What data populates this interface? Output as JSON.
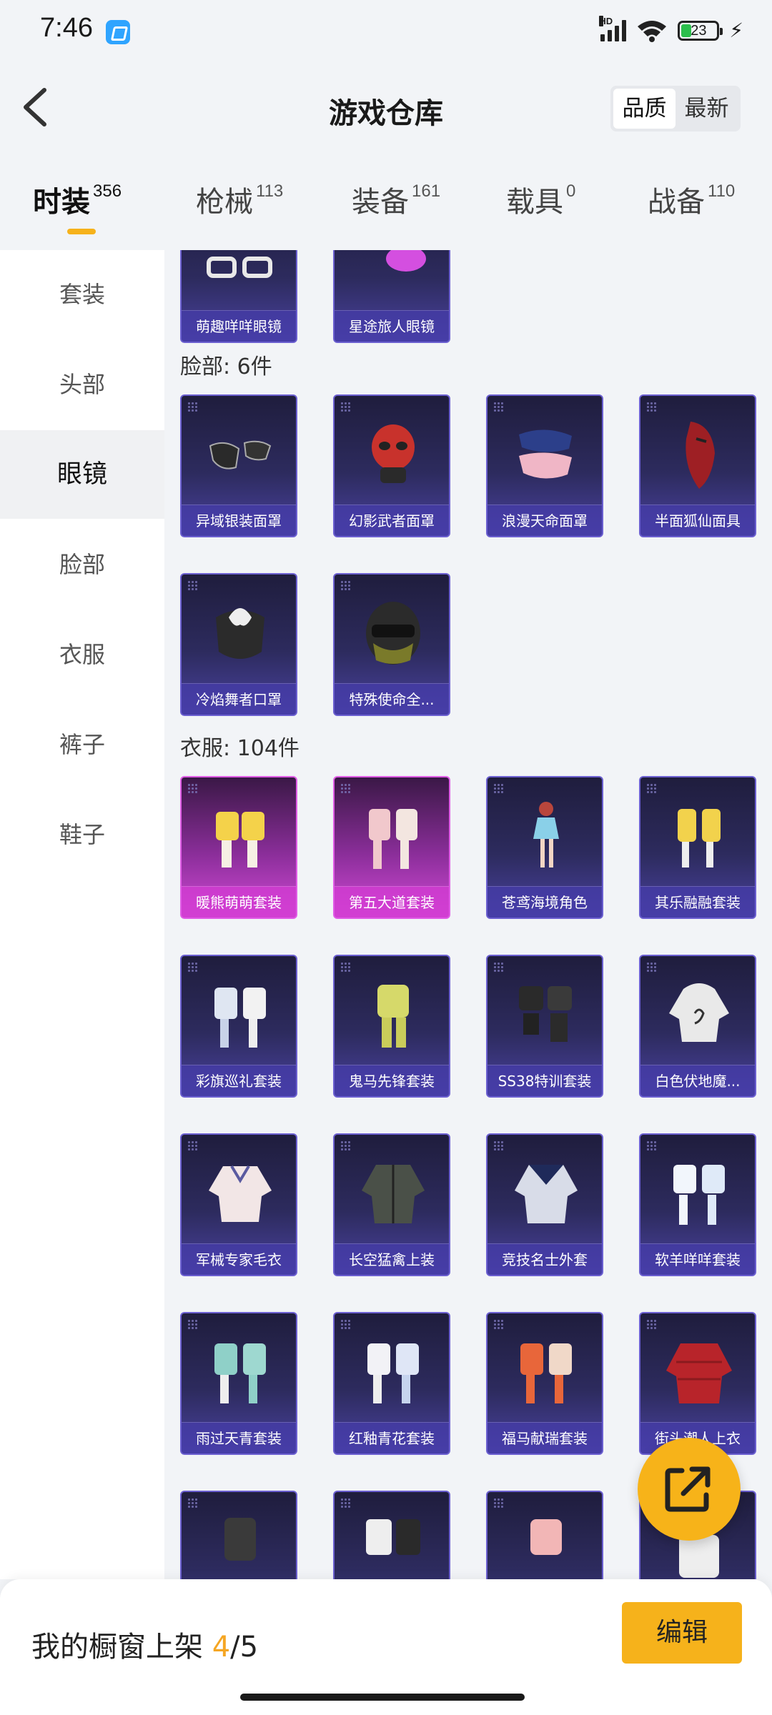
{
  "status_bar": {
    "time": "7:46",
    "network": "HD",
    "battery": "23"
  },
  "header": {
    "title": "游戏仓库",
    "sort_options": [
      "品质",
      "最新"
    ],
    "active_sort": "品质"
  },
  "tabs": [
    {
      "label": "时装",
      "count": "356"
    },
    {
      "label": "枪械",
      "count": "113"
    },
    {
      "label": "装备",
      "count": "161"
    },
    {
      "label": "载具",
      "count": "0"
    },
    {
      "label": "战备",
      "count": "110"
    }
  ],
  "sidebar": {
    "items": [
      "套装",
      "头部",
      "眼镜",
      "脸部",
      "衣服",
      "裤子",
      "鞋子"
    ],
    "active": "眼镜"
  },
  "sections": {
    "glasses_partial": [
      {
        "name": "萌趣咩咩眼镜"
      },
      {
        "name": "星途旅人眼镜"
      }
    ],
    "face": {
      "title": "脸部: 6件",
      "items": [
        {
          "name": "异域银装面罩"
        },
        {
          "name": "幻影武者面罩"
        },
        {
          "name": "浪漫天命面罩"
        },
        {
          "name": "半面狐仙面具"
        },
        {
          "name": "冷焰舞者口罩"
        },
        {
          "name": "特殊使命全..."
        }
      ]
    },
    "clothes": {
      "title": "衣服: 104件",
      "items": [
        {
          "name": "暖熊萌萌套装"
        },
        {
          "name": "第五大道套装"
        },
        {
          "name": "苍鸢海境角色"
        },
        {
          "name": "其乐融融套装"
        },
        {
          "name": "彩旗巡礼套装"
        },
        {
          "name": "鬼马先锋套装"
        },
        {
          "name": "SS38特训套装"
        },
        {
          "name": "白色伏地魔..."
        },
        {
          "name": "军械专家毛衣"
        },
        {
          "name": "长空猛禽上装"
        },
        {
          "name": "竞技名士外套"
        },
        {
          "name": "软羊咩咩套装"
        },
        {
          "name": "雨过天青套装"
        },
        {
          "name": "红釉青花套装"
        },
        {
          "name": "福马献瑞套装"
        },
        {
          "name": "街头潮人上衣"
        }
      ]
    }
  },
  "bottom": {
    "showcase_label": "我的橱窗上架",
    "showcase_current": "4",
    "showcase_total": "/5",
    "edit_label": "编辑"
  },
  "colors": {
    "accent": "#f6b21b",
    "card_purple": "#4a42a0",
    "card_pink": "#d24ad6"
  }
}
